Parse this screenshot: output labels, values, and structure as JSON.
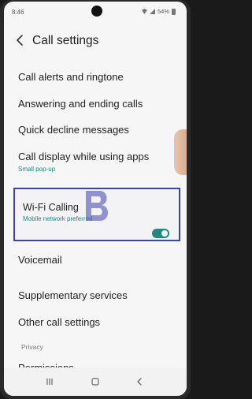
{
  "status_bar": {
    "time": "8:46",
    "battery": "54%"
  },
  "header": {
    "title": "Call settings"
  },
  "menu": {
    "call_alerts": "Call alerts and ringtone",
    "answering": "Answering and ending calls",
    "quick_decline": "Quick decline messages",
    "call_display": "Call display while using apps",
    "call_display_sub": "Small pop-up",
    "wifi_calling": "Wi-Fi Calling",
    "wifi_calling_sub": "Mobile network preferred",
    "wifi_calling_enabled": true,
    "voicemail": "Voicemail",
    "supplementary": "Supplementary services",
    "other": "Other call settings",
    "privacy_header": "Privacy",
    "permissions": "Permissions"
  },
  "colors": {
    "accent": "#1a8a7e",
    "highlight_box": "#3c43a6",
    "watermark": "#4b52b8"
  },
  "icons": {
    "back": "chevron-left-icon",
    "nav_recents": "recents-icon",
    "nav_home": "home-icon",
    "nav_back": "back-nav-icon"
  }
}
